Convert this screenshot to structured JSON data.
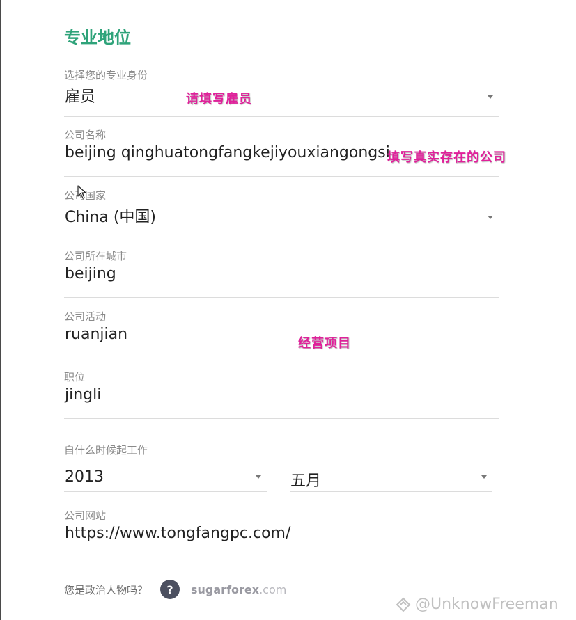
{
  "title": "专业地位",
  "fields": {
    "profession": {
      "label": "选择您的专业身份",
      "value": "雇员"
    },
    "company_name": {
      "label": "公司名称",
      "value": "beijing qinghuatongfangkejiyouxiangongsi"
    },
    "company_country": {
      "label": "公司国家",
      "value": "China (中国)"
    },
    "company_city": {
      "label": "公司所在城市",
      "value": "beijing"
    },
    "company_activity": {
      "label": "公司活动",
      "value": "ruanjian"
    },
    "position": {
      "label": "职位",
      "value": "jingli"
    },
    "company_website": {
      "label": "公司网站",
      "value": "https://www.tongfangpc.com/"
    }
  },
  "work_since": {
    "label": "自什么时候起工作",
    "year": "2013",
    "month": "五月"
  },
  "pep": {
    "question": "您是政治人物吗？",
    "help_symbol": "?",
    "brand_bold": "sugarforex",
    "brand_tail": ".com"
  },
  "annotations": {
    "profession_note": "请填写雇员",
    "company_note": "填写真实存在的公司",
    "activity_note": "经营项目"
  },
  "watermark": "@UnknowFreeman",
  "colors": {
    "accent": "#2fa37a",
    "annotation": "#e0209a",
    "help_badge": "#4c5060"
  },
  "icons": [
    "chevron-down-icon",
    "help-icon",
    "mouse-cursor-icon",
    "watermark-logo-icon"
  ]
}
